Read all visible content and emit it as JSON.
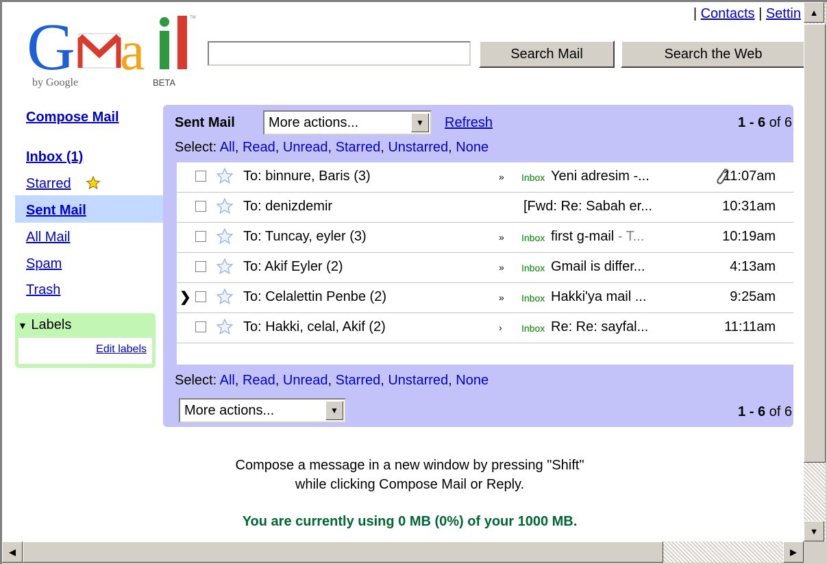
{
  "header": {
    "logo_word": "Gmail",
    "logo_by": "by Google",
    "logo_beta": "BETA",
    "logo_tm": "TM",
    "links": {
      "sep1": "|",
      "contacts": "Contacts",
      "sep2": "|",
      "settings": "Settin"
    },
    "search_value": "",
    "search_mail_label": "Search Mail",
    "search_web_label": "Search the Web"
  },
  "nav": {
    "compose": "Compose Mail",
    "inbox": "Inbox (1)",
    "starred": "Starred",
    "sent": "Sent Mail",
    "all": "All Mail",
    "spam": "Spam",
    "trash": "Trash",
    "labels_title": "Labels",
    "edit_labels": "Edit labels"
  },
  "list": {
    "folder": "Sent Mail",
    "more_actions": "More actions...",
    "refresh": "Refresh",
    "count_range": "1 - 6",
    "count_of": "of 6",
    "select_prefix": "Select:",
    "select_options": [
      "All",
      "Read",
      "Unread",
      "Starred",
      "Unstarred",
      "None"
    ],
    "separator": ",",
    "rows": [
      {
        "pointer": "",
        "from": "To: binnure, Baris (3)",
        "arrows": "»",
        "tag": "Inbox",
        "subject": "Yeni adresim -...",
        "snippet": "",
        "time": "11:07am",
        "attachment": true
      },
      {
        "pointer": "",
        "from": "To: denizdemir",
        "arrows": "",
        "tag": "",
        "subject": "[Fwd: Re: Sabah er...",
        "snippet": "",
        "time": "10:31am",
        "attachment": false
      },
      {
        "pointer": "",
        "from": "To: Tuncay, eyler (3)",
        "arrows": "»",
        "tag": "Inbox",
        "subject": "first g-mail",
        "snippet": " - T...",
        "time": "10:19am",
        "attachment": false
      },
      {
        "pointer": "",
        "from": "To: Akif Eyler (2)",
        "arrows": "»",
        "tag": "Inbox",
        "subject": "Gmail is differ...",
        "snippet": "",
        "time": "4:13am",
        "attachment": false
      },
      {
        "pointer": "❯",
        "from": "To: Celalettin Penbe (2)",
        "arrows": "»",
        "tag": "Inbox",
        "subject": "Hakki'ya mail ...",
        "snippet": "",
        "time": "9:25am",
        "attachment": false
      },
      {
        "pointer": "",
        "from": "To: Hakki, celal, Akif (2)",
        "arrows": "›",
        "tag": "Inbox",
        "subject": "Re: Re: sayfal...",
        "snippet": "",
        "time": "11:11am",
        "attachment": false
      }
    ]
  },
  "footer": {
    "tip_line1": "Compose a message in a new window by pressing \"Shift\"",
    "tip_line2": "while clicking Compose Mail or Reply.",
    "usage": "You are currently using 0 MB (0%) of your 1000 MB."
  },
  "colors": {
    "panel": "#c3c3f9",
    "nav_highlight": "#c3d9ff",
    "labels_box": "#c3f5b4",
    "link": "#0000cc",
    "usage_text": "#006633"
  }
}
